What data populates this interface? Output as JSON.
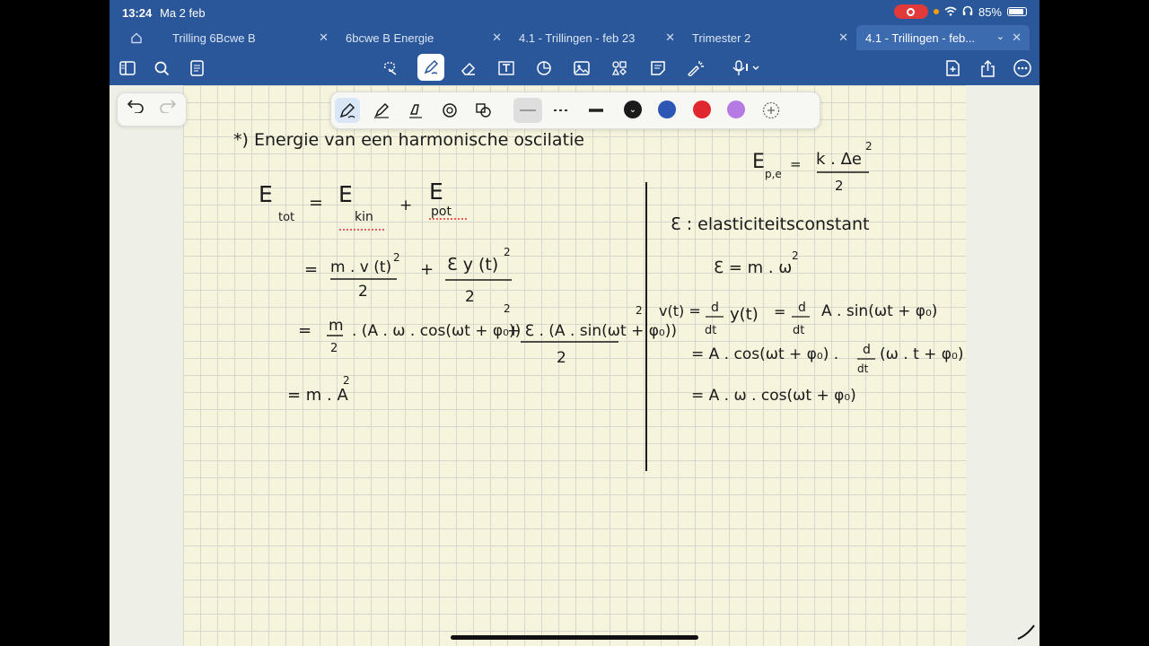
{
  "status": {
    "time": "13:24",
    "date": "Ma 2 feb",
    "battery": "85%"
  },
  "tabs": [
    {
      "label": "Trilling 6Bcwe B"
    },
    {
      "label": "6bcwe B Energie"
    },
    {
      "label": "4.1 - Trillingen - feb 23"
    },
    {
      "label": "Trimester 2"
    },
    {
      "label": "4.1 - Trillingen - feb..."
    }
  ],
  "colors": {
    "chrome": "#2a579a",
    "paper": "#f6f4dc",
    "swatches": [
      "#1a1a1a",
      "#2e56b4",
      "#e0262f",
      "#b57be3"
    ]
  },
  "icons": {
    "toolbar_left": [
      "sidebar-icon",
      "search-icon",
      "document-icon"
    ],
    "toolbar_center": [
      "lasso-icon",
      "pen-icon",
      "eraser-icon",
      "textbox-icon",
      "shapes-icon",
      "image-icon",
      "elements-icon",
      "sticky-note-icon",
      "laser-icon",
      "microphone-icon"
    ],
    "toolbar_right": [
      "new-page-icon",
      "share-icon",
      "more-icon"
    ]
  },
  "notes": {
    "heading": "*) Energie van een harmonische oscilatie",
    "left": {
      "line1_a": "E",
      "line1_a_sub": "tot",
      "line1_eq": "=",
      "line1_b": "E",
      "line1_b_sub": "kin",
      "line1_plus": "+",
      "line1_c": "E",
      "line1_c_sub": "pot",
      "line2_a": "m . v (t)",
      "line2_a_den": "2",
      "line2_plus": "+",
      "line2_b": "ℇ y (t)",
      "line2_b_den": "2",
      "line2_eq": "=",
      "line3_eq": "=",
      "line3_frac_num": "m",
      "line3_frac_den": "2",
      "line3_body": ". (A . ω . cos(ωt + φ₀))",
      "line3_b": "+ ℇ . (A . sin(ωt + φ₀))",
      "line3_b_den": "2",
      "line4": "= m . A"
    },
    "right": {
      "ep_lhs": "E",
      "ep_sub": "p,e",
      "ep_eq": "=",
      "ep_num": "k . Δe",
      "ep_den": "2",
      "def": "ℇ : elasticiteitsconstant",
      "eps": "ℇ = m . ω",
      "v_lhs": "v(t) =",
      "v_d1": "d",
      "v_dt1": "dt",
      "v_y": "y(t)",
      "v_eq": "=",
      "v_d2": "d",
      "v_dt2": "dt",
      "v_rhs": "A . sin(ωt + φ₀)",
      "line2": "= A . cos(ωt + φ₀) .",
      "line2_d": "d",
      "line2_dt": "dt",
      "line2_tail": "(ω . t + φ₀)",
      "line3": "= A . ω . cos(ωt + φ₀)"
    },
    "superscript": "2"
  }
}
